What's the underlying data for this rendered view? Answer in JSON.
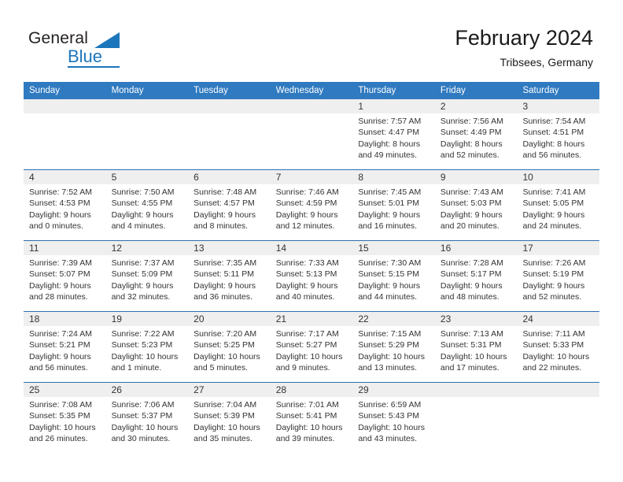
{
  "brand": {
    "line1": "General",
    "line2": "Blue",
    "triangle_color": "#1c76bc"
  },
  "header": {
    "title": "February 2024",
    "subtitle": "Tribsees, Germany",
    "header_bg": "#2f7ac0",
    "row_divider": "#2f6fb0",
    "day_number_band": "#efefef"
  },
  "weekday_headers": [
    "Sunday",
    "Monday",
    "Tuesday",
    "Wednesday",
    "Thursday",
    "Friday",
    "Saturday"
  ],
  "weeks": [
    {
      "days": [
        {
          "num": "",
          "lines": [
            "",
            "",
            "",
            ""
          ]
        },
        {
          "num": "",
          "lines": [
            "",
            "",
            "",
            ""
          ]
        },
        {
          "num": "",
          "lines": [
            "",
            "",
            "",
            ""
          ]
        },
        {
          "num": "",
          "lines": [
            "",
            "",
            "",
            ""
          ]
        },
        {
          "num": "1",
          "lines": [
            "Sunrise: 7:57 AM",
            "Sunset: 4:47 PM",
            "Daylight: 8 hours",
            "and 49 minutes."
          ]
        },
        {
          "num": "2",
          "lines": [
            "Sunrise: 7:56 AM",
            "Sunset: 4:49 PM",
            "Daylight: 8 hours",
            "and 52 minutes."
          ]
        },
        {
          "num": "3",
          "lines": [
            "Sunrise: 7:54 AM",
            "Sunset: 4:51 PM",
            "Daylight: 8 hours",
            "and 56 minutes."
          ]
        }
      ]
    },
    {
      "days": [
        {
          "num": "4",
          "lines": [
            "Sunrise: 7:52 AM",
            "Sunset: 4:53 PM",
            "Daylight: 9 hours",
            "and 0 minutes."
          ]
        },
        {
          "num": "5",
          "lines": [
            "Sunrise: 7:50 AM",
            "Sunset: 4:55 PM",
            "Daylight: 9 hours",
            "and 4 minutes."
          ]
        },
        {
          "num": "6",
          "lines": [
            "Sunrise: 7:48 AM",
            "Sunset: 4:57 PM",
            "Daylight: 9 hours",
            "and 8 minutes."
          ]
        },
        {
          "num": "7",
          "lines": [
            "Sunrise: 7:46 AM",
            "Sunset: 4:59 PM",
            "Daylight: 9 hours",
            "and 12 minutes."
          ]
        },
        {
          "num": "8",
          "lines": [
            "Sunrise: 7:45 AM",
            "Sunset: 5:01 PM",
            "Daylight: 9 hours",
            "and 16 minutes."
          ]
        },
        {
          "num": "9",
          "lines": [
            "Sunrise: 7:43 AM",
            "Sunset: 5:03 PM",
            "Daylight: 9 hours",
            "and 20 minutes."
          ]
        },
        {
          "num": "10",
          "lines": [
            "Sunrise: 7:41 AM",
            "Sunset: 5:05 PM",
            "Daylight: 9 hours",
            "and 24 minutes."
          ]
        }
      ]
    },
    {
      "days": [
        {
          "num": "11",
          "lines": [
            "Sunrise: 7:39 AM",
            "Sunset: 5:07 PM",
            "Daylight: 9 hours",
            "and 28 minutes."
          ]
        },
        {
          "num": "12",
          "lines": [
            "Sunrise: 7:37 AM",
            "Sunset: 5:09 PM",
            "Daylight: 9 hours",
            "and 32 minutes."
          ]
        },
        {
          "num": "13",
          "lines": [
            "Sunrise: 7:35 AM",
            "Sunset: 5:11 PM",
            "Daylight: 9 hours",
            "and 36 minutes."
          ]
        },
        {
          "num": "14",
          "lines": [
            "Sunrise: 7:33 AM",
            "Sunset: 5:13 PM",
            "Daylight: 9 hours",
            "and 40 minutes."
          ]
        },
        {
          "num": "15",
          "lines": [
            "Sunrise: 7:30 AM",
            "Sunset: 5:15 PM",
            "Daylight: 9 hours",
            "and 44 minutes."
          ]
        },
        {
          "num": "16",
          "lines": [
            "Sunrise: 7:28 AM",
            "Sunset: 5:17 PM",
            "Daylight: 9 hours",
            "and 48 minutes."
          ]
        },
        {
          "num": "17",
          "lines": [
            "Sunrise: 7:26 AM",
            "Sunset: 5:19 PM",
            "Daylight: 9 hours",
            "and 52 minutes."
          ]
        }
      ]
    },
    {
      "days": [
        {
          "num": "18",
          "lines": [
            "Sunrise: 7:24 AM",
            "Sunset: 5:21 PM",
            "Daylight: 9 hours",
            "and 56 minutes."
          ]
        },
        {
          "num": "19",
          "lines": [
            "Sunrise: 7:22 AM",
            "Sunset: 5:23 PM",
            "Daylight: 10 hours",
            "and 1 minute."
          ]
        },
        {
          "num": "20",
          "lines": [
            "Sunrise: 7:20 AM",
            "Sunset: 5:25 PM",
            "Daylight: 10 hours",
            "and 5 minutes."
          ]
        },
        {
          "num": "21",
          "lines": [
            "Sunrise: 7:17 AM",
            "Sunset: 5:27 PM",
            "Daylight: 10 hours",
            "and 9 minutes."
          ]
        },
        {
          "num": "22",
          "lines": [
            "Sunrise: 7:15 AM",
            "Sunset: 5:29 PM",
            "Daylight: 10 hours",
            "and 13 minutes."
          ]
        },
        {
          "num": "23",
          "lines": [
            "Sunrise: 7:13 AM",
            "Sunset: 5:31 PM",
            "Daylight: 10 hours",
            "and 17 minutes."
          ]
        },
        {
          "num": "24",
          "lines": [
            "Sunrise: 7:11 AM",
            "Sunset: 5:33 PM",
            "Daylight: 10 hours",
            "and 22 minutes."
          ]
        }
      ]
    },
    {
      "days": [
        {
          "num": "25",
          "lines": [
            "Sunrise: 7:08 AM",
            "Sunset: 5:35 PM",
            "Daylight: 10 hours",
            "and 26 minutes."
          ]
        },
        {
          "num": "26",
          "lines": [
            "Sunrise: 7:06 AM",
            "Sunset: 5:37 PM",
            "Daylight: 10 hours",
            "and 30 minutes."
          ]
        },
        {
          "num": "27",
          "lines": [
            "Sunrise: 7:04 AM",
            "Sunset: 5:39 PM",
            "Daylight: 10 hours",
            "and 35 minutes."
          ]
        },
        {
          "num": "28",
          "lines": [
            "Sunrise: 7:01 AM",
            "Sunset: 5:41 PM",
            "Daylight: 10 hours",
            "and 39 minutes."
          ]
        },
        {
          "num": "29",
          "lines": [
            "Sunrise: 6:59 AM",
            "Sunset: 5:43 PM",
            "Daylight: 10 hours",
            "and 43 minutes."
          ]
        },
        {
          "num": "",
          "lines": [
            "",
            "",
            "",
            ""
          ]
        },
        {
          "num": "",
          "lines": [
            "",
            "",
            "",
            ""
          ]
        }
      ]
    }
  ]
}
